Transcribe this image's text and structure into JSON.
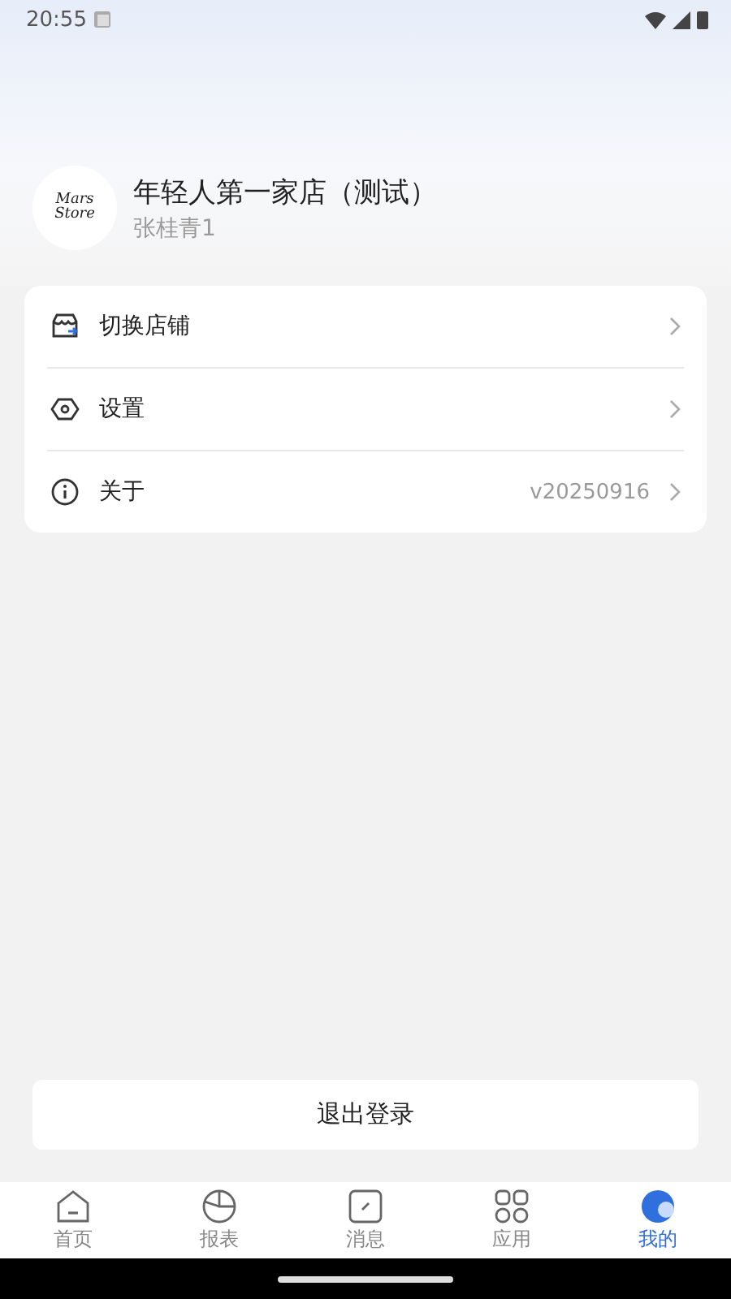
{
  "status_bar": {
    "time": "20:55"
  },
  "profile": {
    "logo_lines": [
      "Mars",
      "Store"
    ],
    "store_name": "年轻人第一家店（测试）",
    "user_name": "张桂青1"
  },
  "menu": [
    {
      "label": "切换店铺"
    },
    {
      "label": "设置"
    },
    {
      "label": "关于",
      "value": "v20250916"
    }
  ],
  "logout_button": "退出登录",
  "tabs": [
    {
      "label": "首页",
      "selected": false
    },
    {
      "label": "报表",
      "selected": false
    },
    {
      "label": "消息",
      "selected": false
    },
    {
      "label": "应用",
      "selected": false
    },
    {
      "label": "我的",
      "selected": true
    }
  ]
}
